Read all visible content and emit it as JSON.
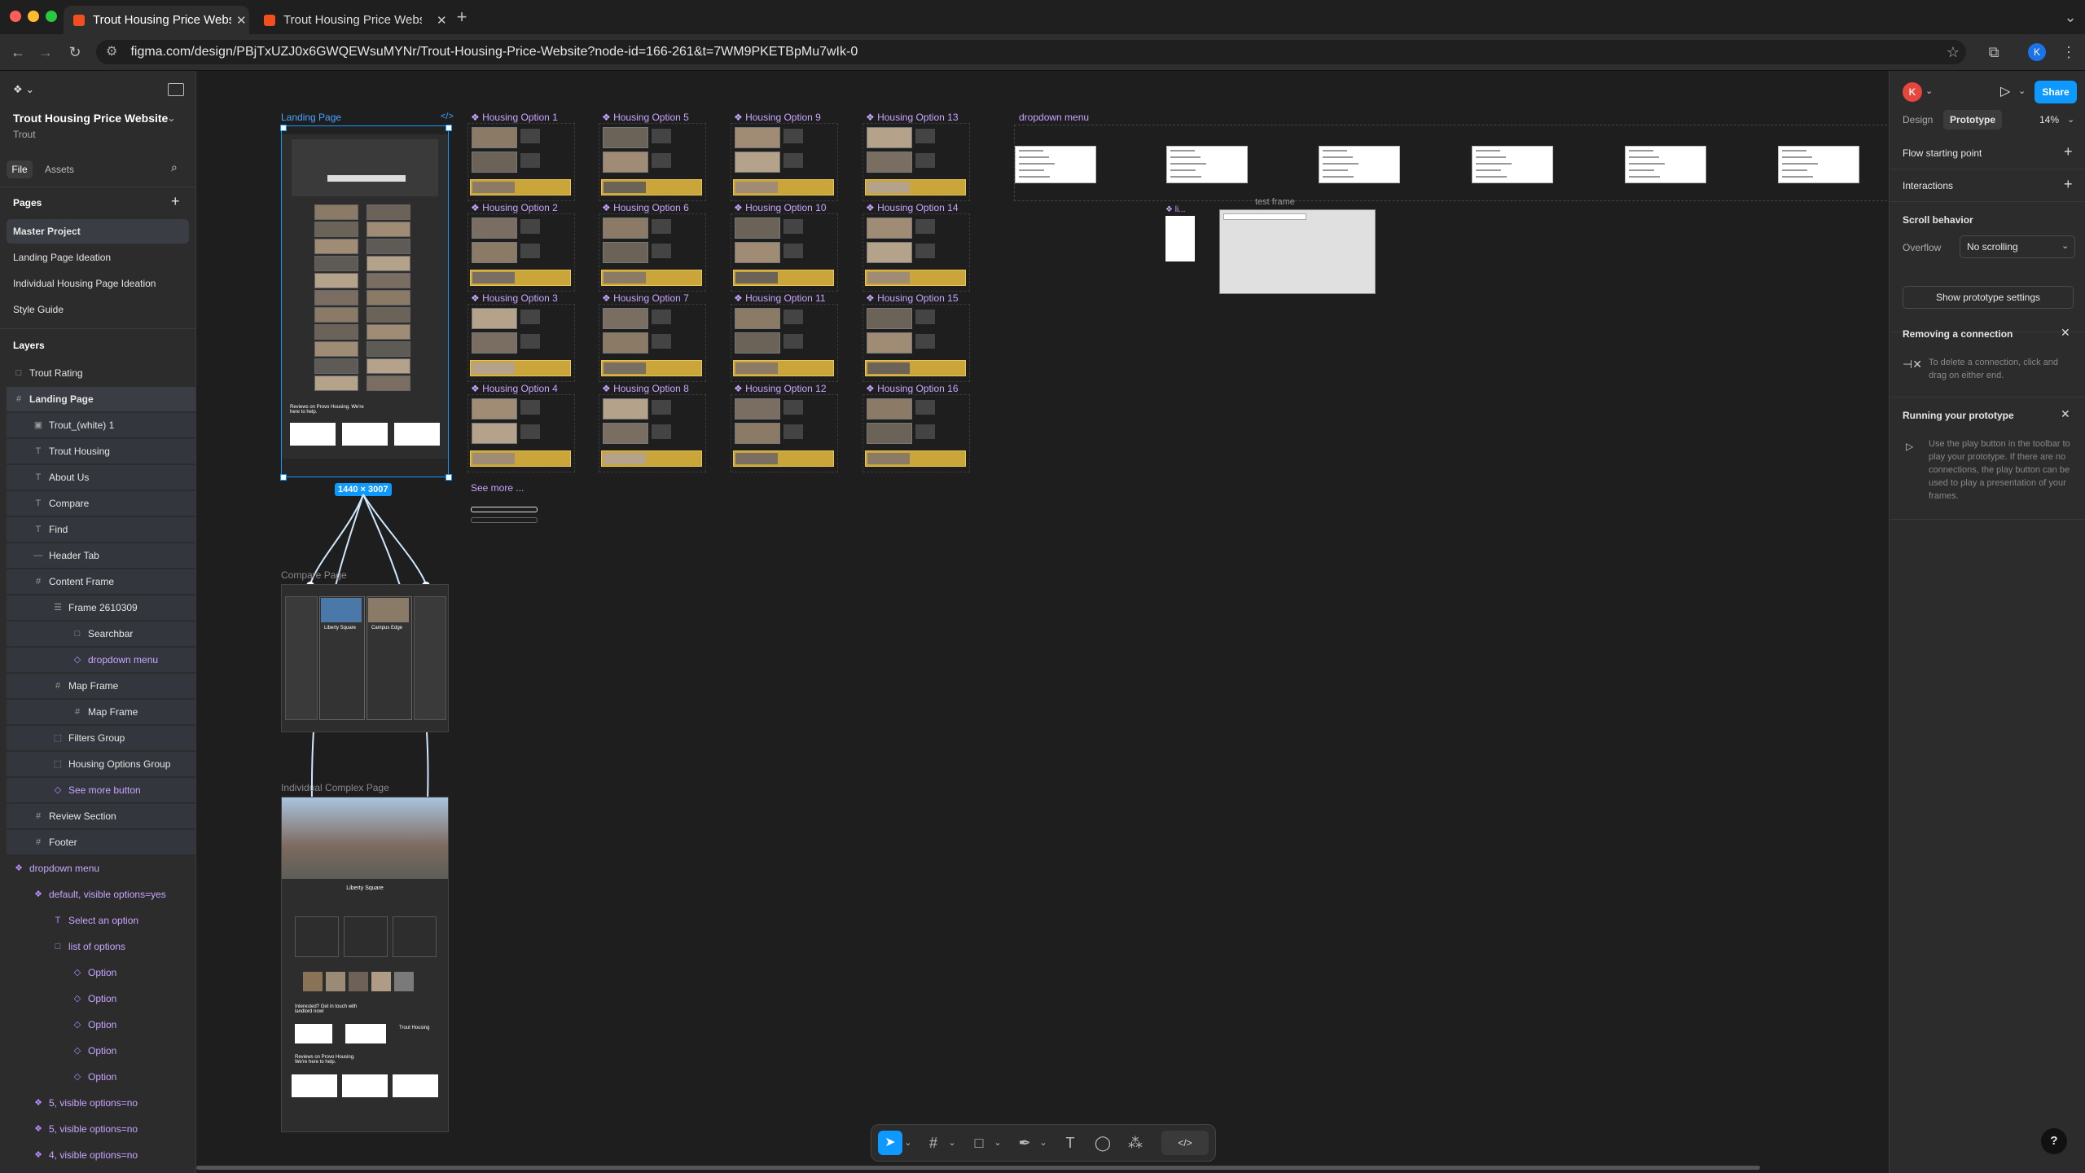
{
  "browser": {
    "tabs": [
      {
        "title": "Trout Housing Price Website",
        "active": true
      },
      {
        "title": "Trout Housing Price Website",
        "active": false
      }
    ],
    "url": "figma.com/design/PBjTxUZJ0x6GWQEWsuMYNr/Trout-Housing-Price-Website?node-id=166-261&t=7WM9PKETBpMu7wIk-0",
    "profile_initial": "K"
  },
  "left_panel": {
    "file_name": "Trout Housing Price Website",
    "team": "Trout",
    "tabs": {
      "file": "File",
      "assets": "Assets"
    },
    "pages_title": "Pages",
    "pages": [
      "Master Project",
      "Landing Page Ideation",
      "Individual Housing Page Ideation",
      "Style Guide"
    ],
    "layers_title": "Layers",
    "layers": [
      {
        "label": "Trout Rating",
        "icon": "frame-icon"
      },
      {
        "label": "Landing Page",
        "icon": "grid-icon"
      },
      {
        "label": "Trout_(white) 1",
        "icon": "image-icon"
      },
      {
        "label": "Trout Housing",
        "icon": "text-icon"
      },
      {
        "label": "About Us",
        "icon": "text-icon"
      },
      {
        "label": "Compare",
        "icon": "text-icon"
      },
      {
        "label": "Find",
        "icon": "text-icon"
      },
      {
        "label": "Header Tab",
        "icon": "line-icon"
      },
      {
        "label": "Content Frame",
        "icon": "grid-icon"
      },
      {
        "label": "Frame 2610309",
        "icon": "autolayout-icon"
      },
      {
        "label": "Searchbar",
        "icon": "frame-icon"
      },
      {
        "label": "dropdown menu",
        "icon": "instance-icon"
      },
      {
        "label": "Map Frame",
        "icon": "grid-icon"
      },
      {
        "label": "Map Frame",
        "icon": "grid-icon"
      },
      {
        "label": "Filters Group",
        "icon": "group-icon"
      },
      {
        "label": "Housing Options Group",
        "icon": "group-icon"
      },
      {
        "label": "See more button",
        "icon": "instance-icon"
      },
      {
        "label": "Review Section",
        "icon": "grid-icon"
      },
      {
        "label": "Footer",
        "icon": "grid-icon"
      },
      {
        "label": "dropdown menu",
        "icon": "component-icon"
      },
      {
        "label": "default, visible options=yes",
        "icon": "component-icon"
      },
      {
        "label": "Select an option",
        "icon": "text-icon"
      },
      {
        "label": "list of options",
        "icon": "frame-icon"
      },
      {
        "label": "Option",
        "icon": "instance-icon"
      },
      {
        "label": "Option",
        "icon": "instance-icon"
      },
      {
        "label": "Option",
        "icon": "instance-icon"
      },
      {
        "label": "Option",
        "icon": "instance-icon"
      },
      {
        "label": "Option",
        "icon": "instance-icon"
      },
      {
        "label": "5, visible options=no",
        "icon": "component-icon"
      },
      {
        "label": "5, visible options=no",
        "icon": "component-icon"
      },
      {
        "label": "4, visible options=no",
        "icon": "component-icon"
      }
    ]
  },
  "canvas": {
    "landing_label": "Landing Page",
    "compare_label": "Compare Page",
    "complex_label": "Individual Complex Page",
    "dropdown_label": "dropdown menu",
    "test_frame_label": "test frame",
    "see_more_label": "See more ...",
    "size_badge": {
      "w": "1440",
      "h": "3007"
    },
    "housing_options": [
      "Housing Option 1",
      "Housing Option 5",
      "Housing Option 9",
      "Housing Option 13",
      "Housing Option 2",
      "Housing Option 6",
      "Housing Option 10",
      "Housing Option 14",
      "Housing Option 3",
      "Housing Option 7",
      "Housing Option 11",
      "Housing Option 15",
      "Housing Option 4",
      "Housing Option 8",
      "Housing Option 12",
      "Housing Option 16"
    ],
    "complex_title": "Liberty Square",
    "compare_titles": [
      "Liberty Square",
      "Campus Edge"
    ],
    "reviews_heading": "Reviews on Provo Housing. We're here to help.",
    "interested_heading": "Interested? Get in touch with landlord now!",
    "logo_text": "Trout Housing"
  },
  "right_panel": {
    "avatar_initial": "K",
    "share": "Share",
    "tabs": {
      "design": "Design",
      "prototype": "Prototype"
    },
    "zoom": "14%",
    "flow_starting_point": "Flow starting point",
    "interactions": "Interactions",
    "scroll_behavior": "Scroll behavior",
    "overflow_label": "Overflow",
    "overflow_value": "No scrolling",
    "show_settings": "Show prototype settings",
    "removing_title": "Removing a connection",
    "removing_text": "To delete a connection, click and drag on either end.",
    "running_title": "Running your prototype",
    "running_text": "Use the play button in the toolbar to play your prototype. If there are no connections, the play button can be used to play a presentation of your frames."
  },
  "help": "?"
}
